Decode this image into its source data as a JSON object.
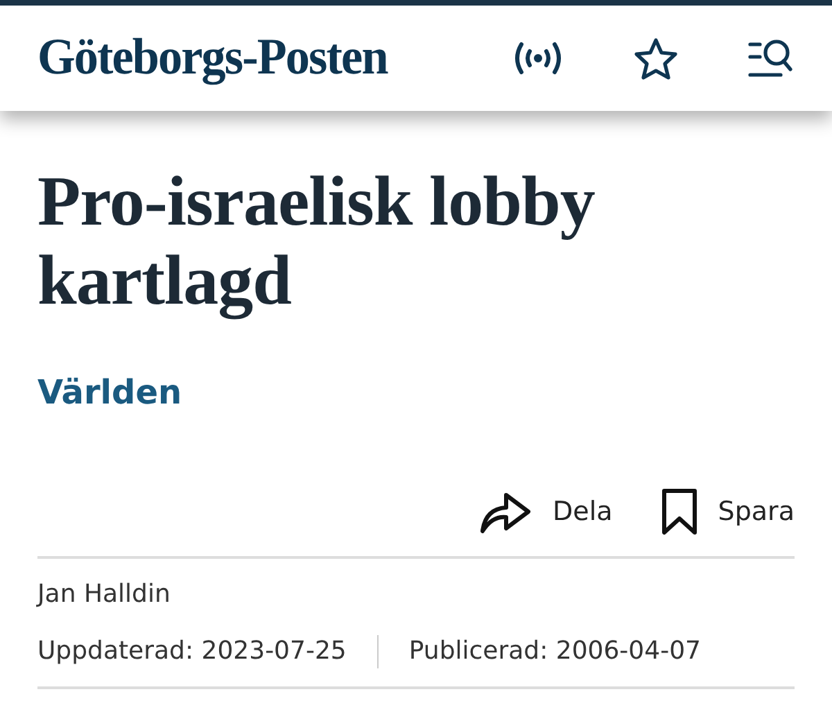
{
  "header": {
    "logo": "Göteborgs-Posten"
  },
  "article": {
    "title": "Pro-israelisk lobby kartlagd",
    "category": "Världen"
  },
  "actions": [
    {
      "label": "Dela",
      "kind": "share"
    },
    {
      "label": "Spara",
      "kind": "save"
    }
  ],
  "byline": {
    "author": "Jan Halldin",
    "updated": "Uppdaterad: 2023-07-25",
    "published": "Publicerad: 2006-04-07"
  }
}
